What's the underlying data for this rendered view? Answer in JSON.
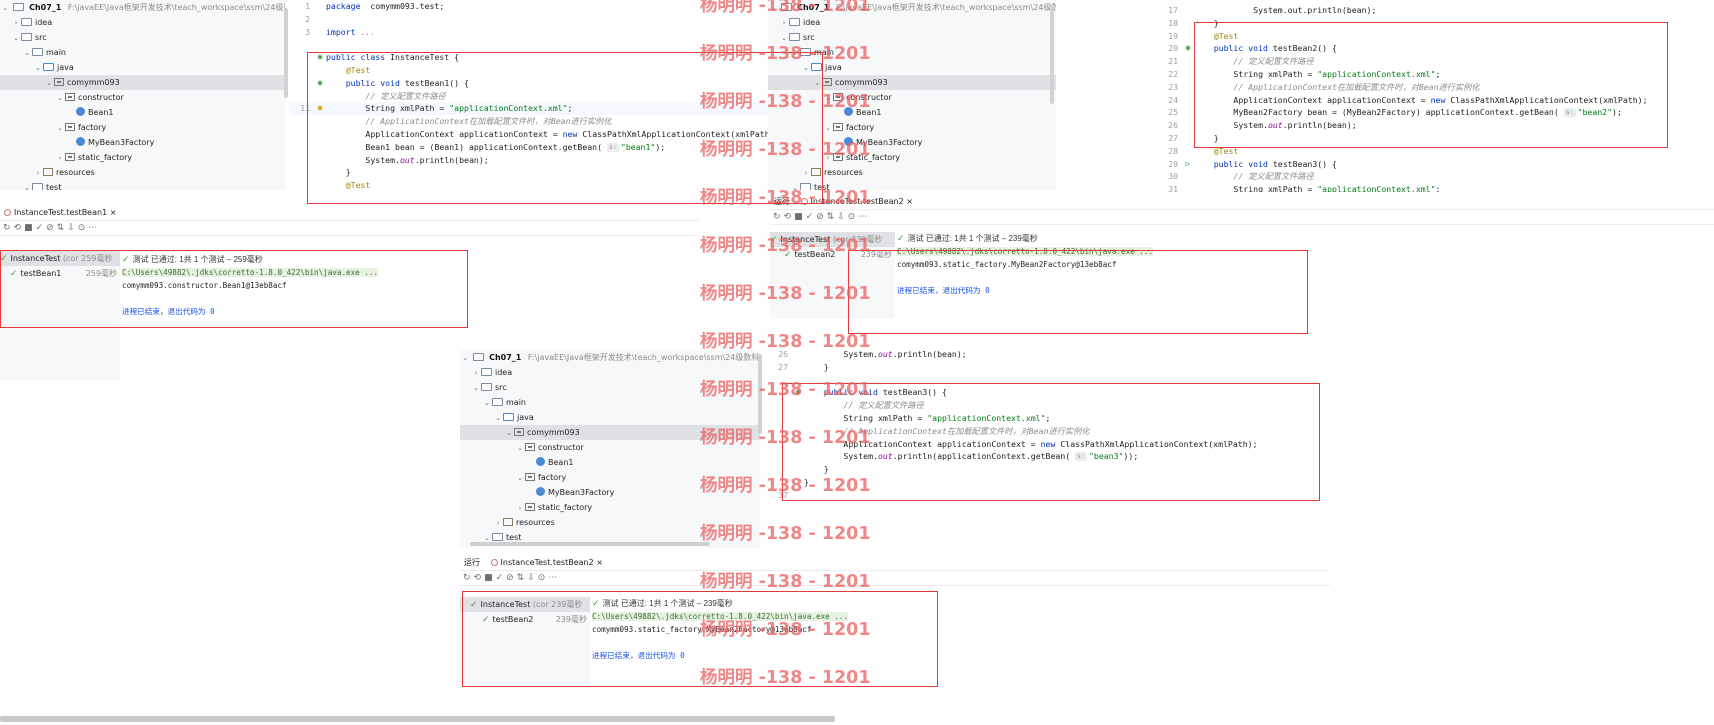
{
  "project": {
    "name": "Ch07_1",
    "path": "F:\\javaEE\\Java框架开发技术\\teach_workspace\\ssm\\24级数科4班\\",
    "tree_a": [
      {
        "label": "idea",
        "chev": "›",
        "icon": "folder"
      },
      {
        "label": "src",
        "chev": "⌄",
        "icon": "folder"
      },
      {
        "label": "main",
        "chev": "⌄",
        "icon": "folder"
      },
      {
        "label": "java",
        "chev": "⌄",
        "icon": "folder-blue"
      },
      {
        "label": "comymm093",
        "chev": "⌄",
        "icon": "package"
      },
      {
        "label": "constructor",
        "chev": "⌄",
        "icon": "package"
      },
      {
        "label": "Bean1",
        "chev": "",
        "icon": "class"
      },
      {
        "label": "factory",
        "chev": "⌄",
        "icon": "package"
      },
      {
        "label": "MyBean3Factory",
        "chev": "",
        "icon": "class"
      },
      {
        "label": "static_factory",
        "chev": "›",
        "icon": "package"
      },
      {
        "label": "resources",
        "chev": "›",
        "icon": "resources"
      },
      {
        "label": "test",
        "chev": "⌄",
        "icon": "folder"
      }
    ],
    "tree_b": [
      {
        "label": "idea",
        "chev": "›",
        "icon": "folder"
      },
      {
        "label": "src",
        "chev": "⌄",
        "icon": "folder"
      },
      {
        "label": "main",
        "chev": "⌄",
        "icon": "folder"
      },
      {
        "label": "java",
        "chev": "⌄",
        "icon": "folder-blue"
      },
      {
        "label": "comymm093",
        "chev": "⌄",
        "icon": "package"
      },
      {
        "label": "constructor",
        "chev": "⌄",
        "icon": "package"
      },
      {
        "label": "Bean1",
        "chev": "",
        "icon": "class"
      },
      {
        "label": "factory",
        "chev": "⌄",
        "icon": "package"
      },
      {
        "label": "MyBean3Factory",
        "chev": "",
        "icon": "class"
      },
      {
        "label": "static_factory",
        "chev": "›",
        "icon": "package"
      },
      {
        "label": "resources",
        "chev": "›",
        "icon": "resources"
      },
      {
        "label": "test",
        "chev": "⌄",
        "icon": "folder"
      }
    ],
    "tree_c": [
      {
        "label": "idea",
        "chev": "›",
        "icon": "folder"
      },
      {
        "label": "src",
        "chev": "⌄",
        "icon": "folder"
      },
      {
        "label": "main",
        "chev": "⌄",
        "icon": "folder"
      },
      {
        "label": "java",
        "chev": "⌄",
        "icon": "folder-blue"
      },
      {
        "label": "comymm093",
        "chev": "⌄",
        "icon": "package"
      },
      {
        "label": "constructor",
        "chev": "⌄",
        "icon": "package"
      },
      {
        "label": "Bean1",
        "chev": "",
        "icon": "class"
      },
      {
        "label": "factory",
        "chev": "⌄",
        "icon": "package"
      },
      {
        "label": "MyBean3Factory",
        "chev": "",
        "icon": "class"
      },
      {
        "label": "static_factory",
        "chev": "›",
        "icon": "package"
      },
      {
        "label": "resources",
        "chev": "›",
        "icon": "resources"
      },
      {
        "label": "test",
        "chev": "⌄",
        "icon": "folder"
      }
    ]
  },
  "editor_a": {
    "lines": [
      {
        "n": "1",
        "segs": [
          [
            "kw",
            "package"
          ],
          [
            "",
            "  comymm093.test;"
          ]
        ]
      },
      {
        "n": "2",
        "segs": []
      },
      {
        "n": "3",
        "segs": [
          [
            "kw",
            "import"
          ],
          [
            "",
            " "
          ],
          [
            "cm",
            "..."
          ]
        ]
      },
      {
        "n": "",
        "segs": []
      },
      {
        "n": "",
        "segs": [
          [
            "kw",
            "public class"
          ],
          [
            "",
            " InstanceTest {"
          ]
        ]
      },
      {
        "n": "",
        "segs": [
          [
            "an",
            "    @Test"
          ]
        ]
      },
      {
        "n": "",
        "segs": [
          [
            "kw",
            "    public void"
          ],
          [
            "",
            " testBean1() {"
          ]
        ]
      },
      {
        "n": "",
        "segs": [
          [
            "cm",
            "        // 定义配置文件路径"
          ]
        ]
      },
      {
        "n": "11",
        "segs": [
          [
            "",
            "        String xmlPath = "
          ],
          [
            "st",
            "\"applicationContext.xml\""
          ],
          [
            "",
            ";"
          ]
        ]
      },
      {
        "n": "",
        "segs": [
          [
            "cm",
            "        // ApplicationContext在加载配置文件时，对Bean进行实例化"
          ]
        ]
      },
      {
        "n": "",
        "segs": [
          [
            "",
            "        ApplicationContext applicationContext = "
          ],
          [
            "kw",
            "new"
          ],
          [
            "",
            " ClassPathXmlApplicationContext(xmlPath);"
          ]
        ]
      },
      {
        "n": "",
        "segs": [
          [
            "",
            "        Bean1 bean = (Bean1) applicationContext.getBean( "
          ],
          [
            "hint",
            "s:"
          ],
          [
            "st",
            "\"bean1\""
          ],
          [
            "",
            ");"
          ]
        ]
      },
      {
        "n": "",
        "segs": [
          [
            "",
            "        System."
          ],
          [
            "fd",
            "out"
          ],
          [
            "",
            ".println(bean);"
          ]
        ]
      },
      {
        "n": "",
        "segs": [
          [
            "",
            "    }"
          ]
        ]
      },
      {
        "n": "",
        "segs": [
          [
            "an",
            "    @Test"
          ]
        ]
      }
    ]
  },
  "editor_b": {
    "lines": [
      {
        "n": "17",
        "segs": [
          [
            "",
            "            System.out.println(bean);"
          ]
        ]
      },
      {
        "n": "18",
        "segs": [
          [
            "",
            "    }"
          ]
        ]
      },
      {
        "n": "19",
        "segs": [
          [
            "an",
            "    @Test"
          ]
        ]
      },
      {
        "n": "20",
        "segs": [
          [
            "kw",
            "    public void"
          ],
          [
            "",
            " testBean2() {"
          ]
        ]
      },
      {
        "n": "21",
        "segs": [
          [
            "cm",
            "        // 定义配置文件路径"
          ]
        ]
      },
      {
        "n": "22",
        "segs": [
          [
            "",
            "        String xmlPath = "
          ],
          [
            "st",
            "\"applicationContext.xml\""
          ],
          [
            "",
            ";"
          ]
        ]
      },
      {
        "n": "23",
        "segs": [
          [
            "cm",
            "        // ApplicationContext在加载配置文件时，对Bean进行实例化"
          ]
        ]
      },
      {
        "n": "24",
        "segs": [
          [
            "",
            "        ApplicationContext applicationContext = "
          ],
          [
            "kw",
            "new"
          ],
          [
            "",
            " ClassPathXmlApplicationContext(xmlPath);"
          ]
        ]
      },
      {
        "n": "25",
        "segs": [
          [
            "",
            "        MyBean2Factory bean = (MyBean2Factory) applicationContext.getBean( "
          ],
          [
            "hint",
            "s:"
          ],
          [
            "st",
            "\"bean2\""
          ],
          [
            "",
            ");"
          ]
        ]
      },
      {
        "n": "26",
        "segs": [
          [
            "",
            "        System."
          ],
          [
            "fd",
            "out"
          ],
          [
            "",
            ".println(bean);"
          ]
        ]
      },
      {
        "n": "27",
        "segs": [
          [
            "",
            "    }"
          ]
        ]
      },
      {
        "n": "28",
        "segs": [
          [
            "an",
            "    @Test"
          ]
        ]
      },
      {
        "n": "29",
        "segs": [
          [
            "kw",
            "    public void"
          ],
          [
            "",
            " testBean3() {"
          ]
        ]
      },
      {
        "n": "30",
        "segs": [
          [
            "cm",
            "        // 定义配置文件路径"
          ]
        ]
      },
      {
        "n": "31",
        "segs": [
          [
            "",
            "        String xmlPath = "
          ],
          [
            "st",
            "\"applicationContext.xml\""
          ],
          [
            "",
            ";"
          ]
        ]
      }
    ]
  },
  "editor_c": {
    "lines": [
      {
        "n": "26",
        "segs": [
          [
            "",
            "        System."
          ],
          [
            "fd",
            "out"
          ],
          [
            "",
            ".println(bean);"
          ]
        ]
      },
      {
        "n": "27",
        "segs": [
          [
            "",
            "    }"
          ]
        ]
      },
      {
        "n": "",
        "segs": []
      },
      {
        "n": "",
        "segs": [
          [
            "kw",
            "    public void"
          ],
          [
            "",
            " testBean3() {"
          ]
        ]
      },
      {
        "n": "",
        "segs": [
          [
            "cm",
            "        // 定义配置文件路径"
          ]
        ]
      },
      {
        "n": "",
        "segs": [
          [
            "",
            "        String xmlPath = "
          ],
          [
            "st",
            "\"applicationContext.xml\""
          ],
          [
            "",
            ";"
          ]
        ]
      },
      {
        "n": "",
        "segs": [
          [
            "cm",
            "        // ApplicationContext在加载配置文件时，对Bean进行实例化"
          ]
        ]
      },
      {
        "n": "",
        "segs": [
          [
            "",
            "        ApplicationContext applicationContext = "
          ],
          [
            "kw",
            "new"
          ],
          [
            "",
            " ClassPathXmlApplicationContext(xmlPath);"
          ]
        ]
      },
      {
        "n": "",
        "segs": [
          [
            "",
            "        System."
          ],
          [
            "fd",
            "out"
          ],
          [
            "",
            ".println(applicationContext.getBean( "
          ],
          [
            "hint",
            "s:"
          ],
          [
            "st",
            "\"bean3\""
          ],
          [
            "",
            "));"
          ]
        ]
      },
      {
        "n": "",
        "segs": [
          [
            "",
            "    }"
          ]
        ]
      },
      {
        "n": "",
        "segs": [
          [
            "",
            "}"
          ]
        ]
      },
      {
        "n": "37",
        "segs": []
      }
    ]
  },
  "run_a": {
    "tab": "InstanceTest.testBean1",
    "root": "InstanceTest",
    "root_dur": "(cor 259毫秒",
    "child": "testBean1",
    "child_dur": "259毫秒",
    "pass": "测试 已通过: 1共 1 个测试 – 259毫秒",
    "cmd": "C:\\Users\\49882\\.jdks\\corretto-1.8.0_422\\bin\\java.exe ...",
    "out": "comymm093.constructor.Bean1@13eb8acf",
    "exit": "进程已结束，退出代码为 0"
  },
  "run_b": {
    "label": "运行",
    "tab": "InstanceTest.testBean2",
    "root": "InstanceTest",
    "root_dur": "(cor 239毫秒",
    "child": "testBean2",
    "child_dur": "239毫秒",
    "pass": "测试 已通过: 1共 1 个测试 – 239毫秒",
    "cmd": "C:\\Users\\49882\\.jdks\\corretto-1.8.0_422\\bin\\java.exe ...",
    "out": "comymm093.static_factory.MyBean2Factory@13eb8acf",
    "exit": "进程已结束，退出代码为 0"
  },
  "run_c": {
    "label": "运行",
    "tab": "InstanceTest.testBean2",
    "root": "InstanceTest",
    "root_dur": "(cor 239毫秒",
    "child": "testBean2",
    "child_dur": "239毫秒",
    "pass": "测试 已通过: 1共 1 个测试 – 239毫秒",
    "cmd": "C:\\Users\\49882\\.jdks\\corretto-1.8.0_422\\bin\\java.exe ...",
    "out": "comymm093.static_factory.MyBean2Factory@13eb8acf",
    "exit": "进程已结束，退出代码为 0"
  },
  "watermark": "杨明明 -138 - 1201",
  "colors": {
    "highlight_box": "#e03a3a",
    "watermark": "#e86060"
  }
}
